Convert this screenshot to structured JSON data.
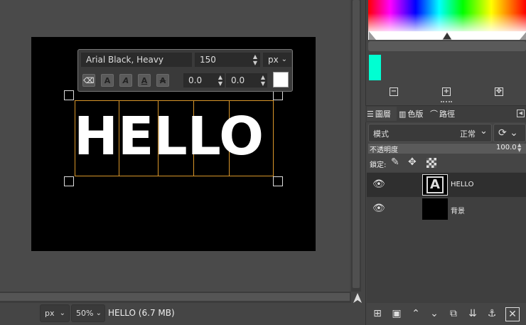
{
  "canvas": {
    "text": "HELLO"
  },
  "text_toolbar": {
    "font": "Arial Black, Heavy",
    "size": "150",
    "unit": "px",
    "baseline_value": "0.0",
    "kerning_value": "0.0",
    "color": "#ffffff"
  },
  "statusbar": {
    "unit": "px",
    "zoom": "50%",
    "info": "HELLO (6.7 MB)"
  },
  "dock": {
    "fg_color": "#00ffd2",
    "tabs": [
      {
        "label": "圖層"
      },
      {
        "label": "色版"
      },
      {
        "label": "路徑"
      }
    ],
    "mode_label": "模式",
    "mode_value": "正常",
    "opacity_label": "不透明度",
    "opacity_value": "100.0",
    "lock_label": "鎖定:",
    "layers": [
      {
        "name": "HELLO"
      },
      {
        "name": "背景"
      }
    ]
  }
}
